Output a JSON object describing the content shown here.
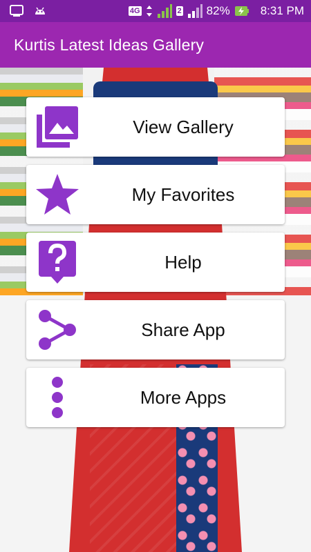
{
  "status_bar": {
    "network_type": "4G",
    "sim_slot": "2",
    "battery": "82%",
    "time": "8:31 PM"
  },
  "app_bar": {
    "title": "Kurtis Latest Ideas Gallery"
  },
  "colors": {
    "status_bar": "#7b1fa2",
    "app_bar": "#9c27b0",
    "icon_accent": "#8e35c9"
  },
  "menu": [
    {
      "label": "View Gallery",
      "icon": "gallery-icon"
    },
    {
      "label": "My Favorites",
      "icon": "star-icon"
    },
    {
      "label": "Help",
      "icon": "help-icon"
    },
    {
      "label": "Share App",
      "icon": "share-icon"
    },
    {
      "label": "More Apps",
      "icon": "more-vert-icon"
    }
  ]
}
